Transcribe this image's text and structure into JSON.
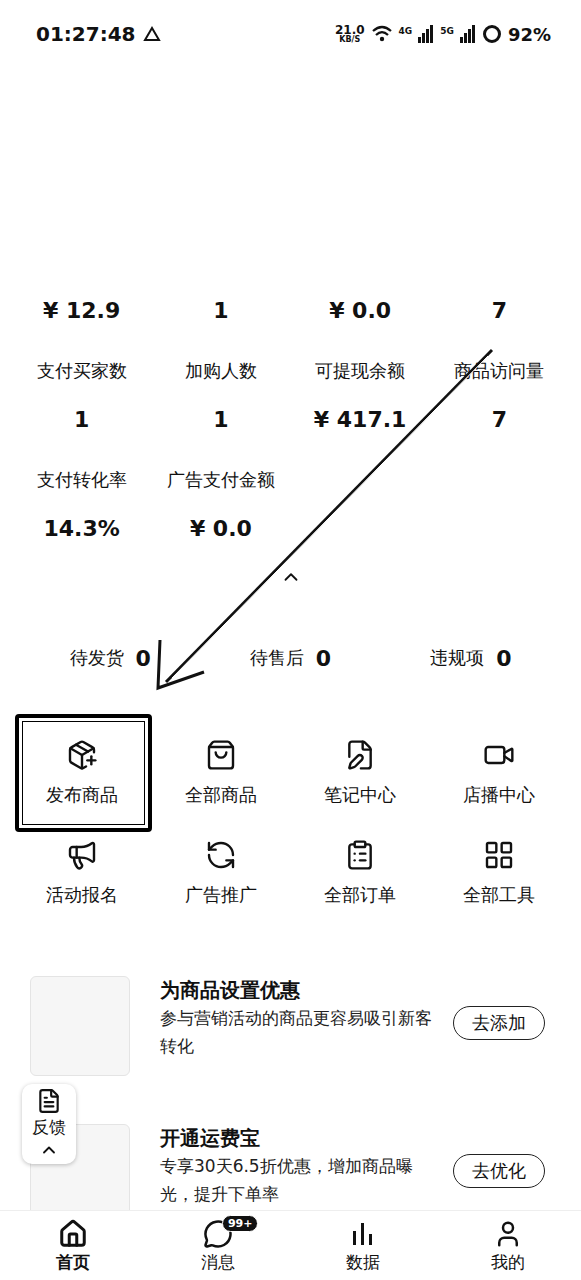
{
  "status_bar": {
    "time": "01:27:48",
    "speed": "21.0",
    "speed_unit": "KB/S",
    "network_1": "4G",
    "network_2": "5G",
    "battery": "92%"
  },
  "stats": {
    "top_values": [
      "¥ 12.9",
      "1",
      "¥ 0.0",
      "7"
    ],
    "items": [
      {
        "label": "支付买家数",
        "value": "1"
      },
      {
        "label": "加购人数",
        "value": "1"
      },
      {
        "label": "可提现余额",
        "value": "¥ 417.1"
      },
      {
        "label": "商品访问量",
        "value": "7"
      },
      {
        "label": "支付转化率",
        "value": "14.3%"
      },
      {
        "label": "广告支付金额",
        "value": "¥ 0.0"
      }
    ]
  },
  "pending": [
    {
      "label": "待发货",
      "count": "0"
    },
    {
      "label": "待售后",
      "count": "0"
    },
    {
      "label": "违规项",
      "count": "0"
    }
  ],
  "tools": [
    {
      "label": "发布商品",
      "highlighted": true
    },
    {
      "label": "全部商品",
      "highlighted": false
    },
    {
      "label": "笔记中心",
      "highlighted": false
    },
    {
      "label": "店播中心",
      "highlighted": false
    },
    {
      "label": "活动报名",
      "highlighted": false
    },
    {
      "label": "广告推广",
      "highlighted": false
    },
    {
      "label": "全部订单",
      "highlighted": false
    },
    {
      "label": "全部工具",
      "highlighted": false
    }
  ],
  "cards": [
    {
      "title": "为商品设置优惠",
      "description": "参与营销活动的商品更容易吸引新客转化",
      "button": "去添加"
    },
    {
      "title": "开通运费宝",
      "description": "专享30天6.5折优惠，增加商品曝光，提升下单率",
      "button": "去优化"
    }
  ],
  "feedback": {
    "label": "反馈"
  },
  "nav": [
    {
      "label": "首页",
      "selected": true
    },
    {
      "label": "消息",
      "selected": false,
      "badge": "99+"
    },
    {
      "label": "数据",
      "selected": false
    },
    {
      "label": "我的",
      "selected": false
    }
  ]
}
